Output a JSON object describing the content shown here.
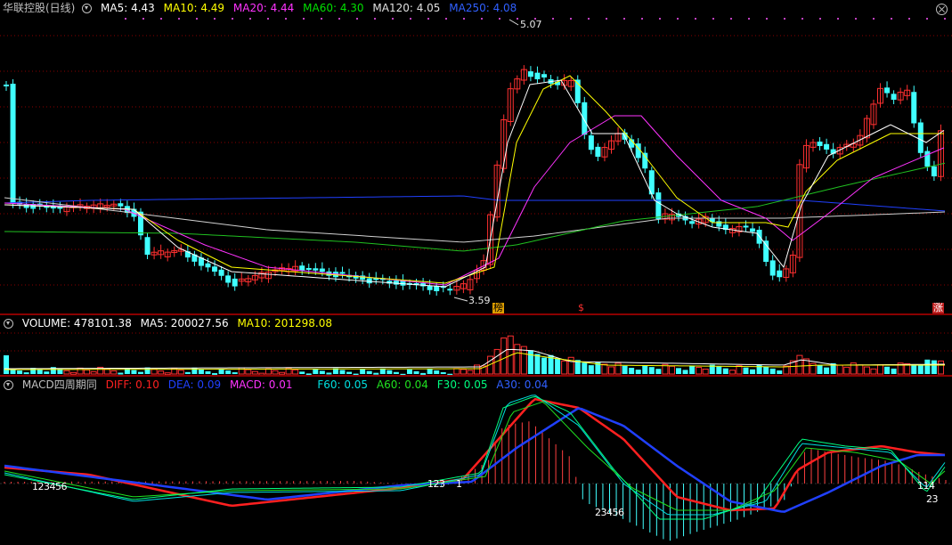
{
  "price_panel": {
    "title": "华联控股(日线)",
    "ma": [
      {
        "label": "MA5: 4.43",
        "color": "#ffffff"
      },
      {
        "label": "MA10: 4.49",
        "color": "#ffff00"
      },
      {
        "label": "MA20: 4.44",
        "color": "#ff33ff"
      },
      {
        "label": "MA60: 4.30",
        "color": "#00e000"
      },
      {
        "label": "MA120: 4.05",
        "color": "#e0e0e0"
      },
      {
        "label": "MA250: 4.08",
        "color": "#3060ff"
      }
    ],
    "high_label": "5.07",
    "low_label": "3.59",
    "tags": [
      {
        "text": "榜",
        "fg": "#000000",
        "bg": "#e0a000"
      },
      {
        "text": "$",
        "fg": "#ff3030",
        "bg": "#000000"
      },
      {
        "text": "涨",
        "fg": "#ffffff",
        "bg": "#c02020"
      }
    ]
  },
  "volume_panel": {
    "labels": [
      {
        "label": "VOLUME: 478101.38",
        "color": "#ffffff"
      },
      {
        "label": "MA5: 200027.56",
        "color": "#ffffff"
      },
      {
        "label": "MA10: 201298.08",
        "color": "#ffff00"
      }
    ]
  },
  "macd_panel": {
    "title": "MACD四周期同",
    "labels": [
      {
        "label": "DIFF: 0.10",
        "color": "#ff2020"
      },
      {
        "label": "DEA: 0.09",
        "color": "#2040ff"
      },
      {
        "label": "MACD: 0.01",
        "color": "#ff33ff"
      },
      {
        "label": "F60: 0.05",
        "color": "#00e0e0"
      },
      {
        "label": "A60: 0.04",
        "color": "#20e020"
      },
      {
        "label": "F30: 0.05",
        "color": "#00ff80"
      },
      {
        "label": "A30: 0.04",
        "color": "#3060ff"
      }
    ],
    "markers": [
      {
        "text": "1 2 3 4 5 6"
      },
      {
        "text": "1 2 3"
      },
      {
        "text": "1"
      },
      {
        "text": "2 3 4 5 6"
      },
      {
        "text": "1 1 4"
      },
      {
        "text": "2 3"
      }
    ]
  },
  "chart_data": {
    "type": "candlestick",
    "ylim": [
      3.5,
      5.15
    ],
    "price_high": 5.07,
    "price_low": 3.59,
    "candles_count": 140,
    "volume_last": 478101.38,
    "macd_last": {
      "diff": 0.1,
      "dea": 0.09,
      "macd": 0.01
    }
  }
}
